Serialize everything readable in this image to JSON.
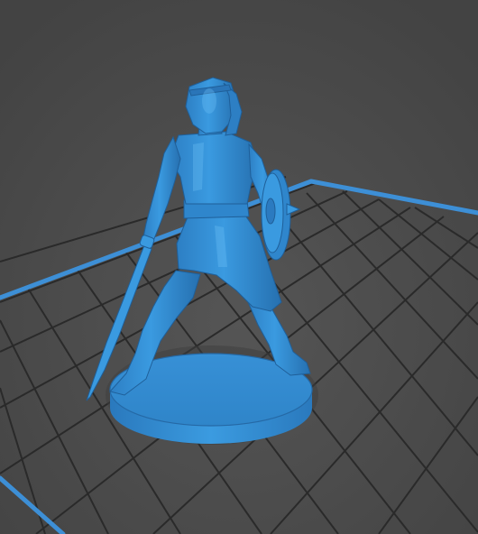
{
  "viewport": {
    "background_color": "#4a4a4a",
    "grid_line_color": "#2a2a2a",
    "grid_line_color_far": "#383838",
    "plate_border_color": "#3d8fd6",
    "model_color": "#3a9ae0",
    "model_shadow_color": "#1f5f99",
    "model_highlight_color": "#6cc0f5"
  },
  "model": {
    "subject": "miniature-warrior-with-sword-and-shield",
    "parts": [
      "base",
      "figure",
      "sword",
      "shield"
    ]
  }
}
